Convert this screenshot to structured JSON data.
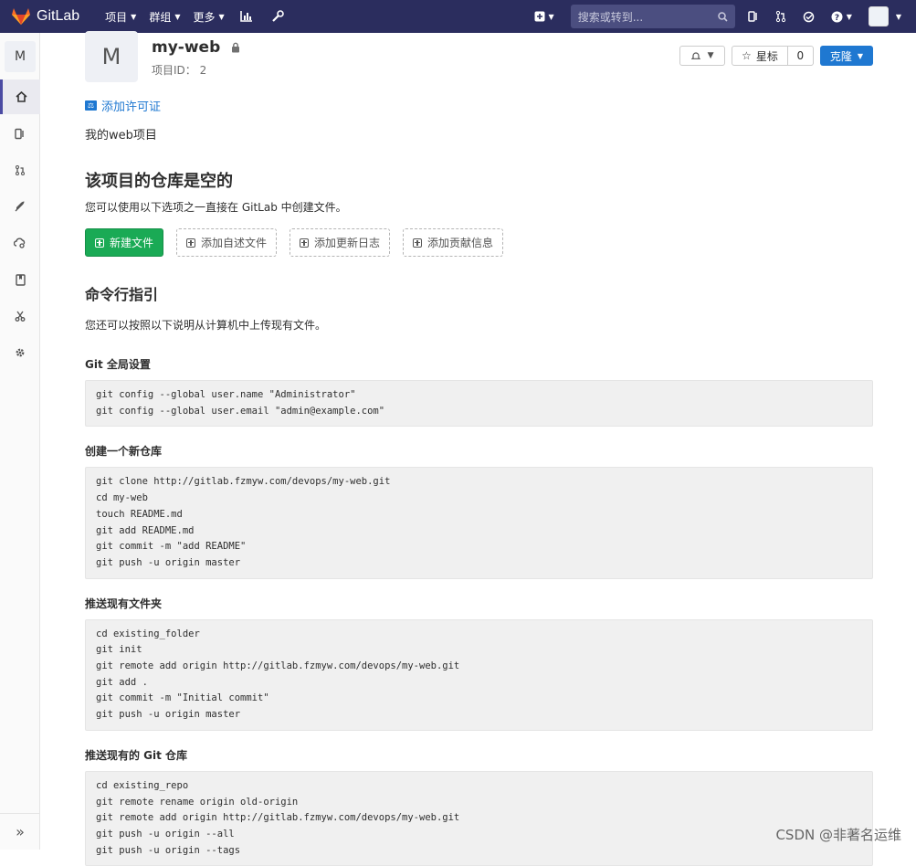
{
  "topbar": {
    "brand": "GitLab",
    "menu": [
      {
        "label": "项目"
      },
      {
        "label": "群组"
      },
      {
        "label": "更多"
      }
    ],
    "search_placeholder": "搜索或转到..."
  },
  "sidebar": {
    "project_letter": "M"
  },
  "project": {
    "avatar_letter": "M",
    "name": "my-web",
    "id_text": "项目ID： 2",
    "star_label": "星标",
    "star_count": "0",
    "clone_label": "克隆",
    "license_link": "添加许可证",
    "description": "我的web项目"
  },
  "empty_repo": {
    "title": "该项目的仓库是空的",
    "subtitle": "您可以使用以下选项之一直接在 GitLab 中创建文件。",
    "buttons": [
      {
        "label": "新建文件"
      },
      {
        "label": "添加自述文件"
      },
      {
        "label": "添加更新日志"
      },
      {
        "label": "添加贡献信息"
      }
    ]
  },
  "cli": {
    "title": "命令行指引",
    "subtitle": "您还可以按照以下说明从计算机中上传现有文件。",
    "sections": [
      {
        "title": "Git 全局设置",
        "lines": [
          "git config --global user.name \"Administrator\"",
          "git config --global user.email \"admin@example.com\""
        ]
      },
      {
        "title": "创建一个新仓库",
        "lines": [
          "git clone http://gitlab.fzmyw.com/devops/my-web.git",
          "cd my-web",
          "touch README.md",
          "git add README.md",
          "git commit -m \"add README\"",
          "git push -u origin master"
        ]
      },
      {
        "title": "推送现有文件夹",
        "lines": [
          "cd existing_folder",
          "git init",
          "git remote add origin http://gitlab.fzmyw.com/devops/my-web.git",
          "git add .",
          "git commit -m \"Initial commit\"",
          "git push -u origin master"
        ]
      },
      {
        "title": "推送现有的 Git 仓库",
        "lines": [
          "cd existing_repo",
          "git remote rename origin old-origin",
          "git remote add origin http://gitlab.fzmyw.com/devops/my-web.git",
          "git push -u origin --all",
          "git push -u origin --tags"
        ]
      }
    ]
  },
  "watermark": "CSDN @非著名运维",
  "colors": {
    "nav_bg": "#2b2d5e",
    "primary": "#1f78d1",
    "success": "#1aaa55"
  }
}
